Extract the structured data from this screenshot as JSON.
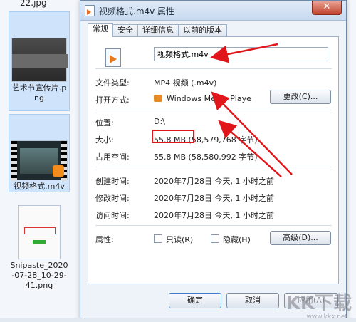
{
  "desktop": {
    "top_file": "22.jpg",
    "files": [
      {
        "name": "艺术节宣传片.png"
      },
      {
        "name": "视频格式.m4v"
      },
      {
        "name": "Snipaste_2020-07-28_10-29-41.png"
      }
    ]
  },
  "dialog": {
    "title": "视频格式.m4v 属性",
    "close": "✕",
    "tabs": [
      "常规",
      "安全",
      "详细信息",
      "以前的版本"
    ],
    "active_tab": "常规",
    "file_name": "视频格式.m4v",
    "rows": {
      "type_label": "文件类型:",
      "type_value": "MP4 视频 (.m4v)",
      "open_label": "打开方式:",
      "open_value": "Windows Media Playe",
      "change_button": "更改(C)...",
      "location_label": "位置:",
      "location_value": "D:\\",
      "size_label": "大小:",
      "size_value": "55.8 MB",
      "size_bytes": "(58,579,768 字节)",
      "disk_label": "占用空间:",
      "disk_value": "55.8 MB (58,580,992 字节)",
      "created_label": "创建时间:",
      "created_value": "2020年7月28日 今天, 1 小时之前",
      "modified_label": "修改时间:",
      "modified_value": "2020年7月28日 今天, 1 小时之前",
      "accessed_label": "访问时间:",
      "accessed_value": "2020年7月28日 今天, 1 小时之前",
      "attr_label": "属性:",
      "readonly": "只读(R)",
      "hidden": "隐藏(H)",
      "advanced_button": "高级(D)..."
    },
    "buttons": {
      "ok": "确定",
      "cancel": "取消",
      "apply": "应用(A)"
    }
  },
  "watermark": "KK下载",
  "watermark_url": "www.kkx.net",
  "colors": {
    "annotation": "#e0161b",
    "accent": "#3d7cc9"
  }
}
